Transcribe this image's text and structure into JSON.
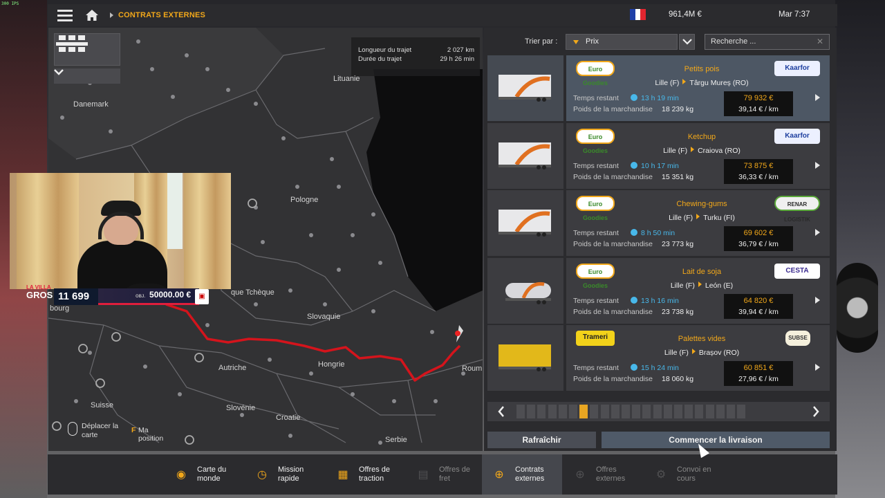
{
  "overlay_fps": "300 IPS",
  "topbar": {
    "breadcrumb": "CONTRATS EXTERNES",
    "money": "961,4M €",
    "clock": "Mar 7:37",
    "flag_colors": [
      "#1f3fa8",
      "#ffffff",
      "#e2252f"
    ]
  },
  "map": {
    "route_info": {
      "length_label": "Longueur du trajet",
      "length_value": "2 027 km",
      "duration_label": "Durée du trajet",
      "duration_value": "29 h 26 min"
    },
    "labels": {
      "danemark": "Danemark",
      "lituanie": "Lituanie",
      "pologne": "Pologne",
      "tcheque": "que Tchèque",
      "slovaquie": "Slovaquie",
      "autriche": "Autriche",
      "hongrie": "Hongrie",
      "suisse": "Suisse",
      "slovenie": "Slovénie",
      "croatie": "Croatie",
      "serbie": "Serbie",
      "roumanie": "Roum",
      "bourg": "bourg"
    },
    "hint": {
      "move_label_line1": "Déplacer la",
      "move_label_line2": "carte",
      "key": "F",
      "position_label": "Ma position"
    },
    "route_color": "#d4141c"
  },
  "stream_overlay": {
    "logo_line1": "LA VILLA",
    "logo_line2": "GROS",
    "count": "11 699",
    "goal_prefix": "OBJ.",
    "goal": "50000.00",
    "goal_currency": "€"
  },
  "sort": {
    "label": "Trier par :",
    "value": "Prix",
    "search_placeholder": "Recherche ..."
  },
  "jobs": [
    {
      "brand": "Euro Goodies",
      "cargo": "Petits pois",
      "from": "Lille (F)",
      "to": "Târgu Mureș (RO)",
      "client": "Kaarfor",
      "time_label": "Temps restant",
      "time": "13 h 19 min",
      "weight_label": "Poids de la marchandise",
      "weight": "18 239 kg",
      "price": "79 932 €",
      "per_km": "39,14 € / km",
      "selected": true
    },
    {
      "brand": "Euro Goodies",
      "cargo": "Ketchup",
      "from": "Lille (F)",
      "to": "Craiova (RO)",
      "client": "Kaarfor",
      "time_label": "Temps restant",
      "time": "10 h 17 min",
      "weight_label": "Poids de la marchandise",
      "weight": "15 351 kg",
      "price": "73 875 €",
      "per_km": "36,33 € / km"
    },
    {
      "brand": "Euro Goodies",
      "cargo": "Chewing-gums",
      "from": "Lille (F)",
      "to": "Turku (FI)",
      "client": "RENAR LOGISTIK",
      "time_label": "Temps restant",
      "time": "8 h 50 min",
      "weight_label": "Poids de la marchandise",
      "weight": "23 773 kg",
      "price": "69 602 €",
      "per_km": "36,79 € / km"
    },
    {
      "brand": "Euro Goodies",
      "cargo": "Lait de soja",
      "from": "Lille (F)",
      "to": "León (E)",
      "client": "CESTA",
      "time_label": "Temps restant",
      "time": "13 h 16 min",
      "weight_label": "Poids de la marchandise",
      "weight": "23 738 kg",
      "price": "64 820 €",
      "per_km": "39,94 € / km"
    },
    {
      "brand": "Trameri",
      "cargo": "Palettes vides",
      "from": "Lille (F)",
      "to": "Brașov (RO)",
      "client": "SUBSE",
      "time_label": "Temps restant",
      "time": "15 h 24 min",
      "weight_label": "Poids de la marchandise",
      "weight": "18 060 kg",
      "price": "60 851 €",
      "per_km": "27,96 € / km"
    }
  ],
  "pager": {
    "pages": 22,
    "current": 6
  },
  "actions": {
    "refresh": "Rafraîchir",
    "start": "Commencer la livraison"
  },
  "bottom_nav": [
    {
      "line1": "Carte du",
      "line2": "monde",
      "icon": "globe-icon"
    },
    {
      "line1": "Mission",
      "line2": "rapide",
      "icon": "clock-icon"
    },
    {
      "line1": "Offres de",
      "line2": "traction",
      "icon": "boxes-icon"
    },
    {
      "line1": "Offres de",
      "line2": "fret",
      "icon": "freight-icon",
      "dim": true
    },
    {
      "line1": "Contrats",
      "line2": "externes",
      "icon": "globe-grid-icon",
      "active": true
    },
    {
      "line1": "Offres",
      "line2": "externes",
      "icon": "globe-grid-icon",
      "dim": true
    },
    {
      "line1": "Convoi en",
      "line2": "cours",
      "icon": "convoy-icon",
      "dim": true
    }
  ]
}
